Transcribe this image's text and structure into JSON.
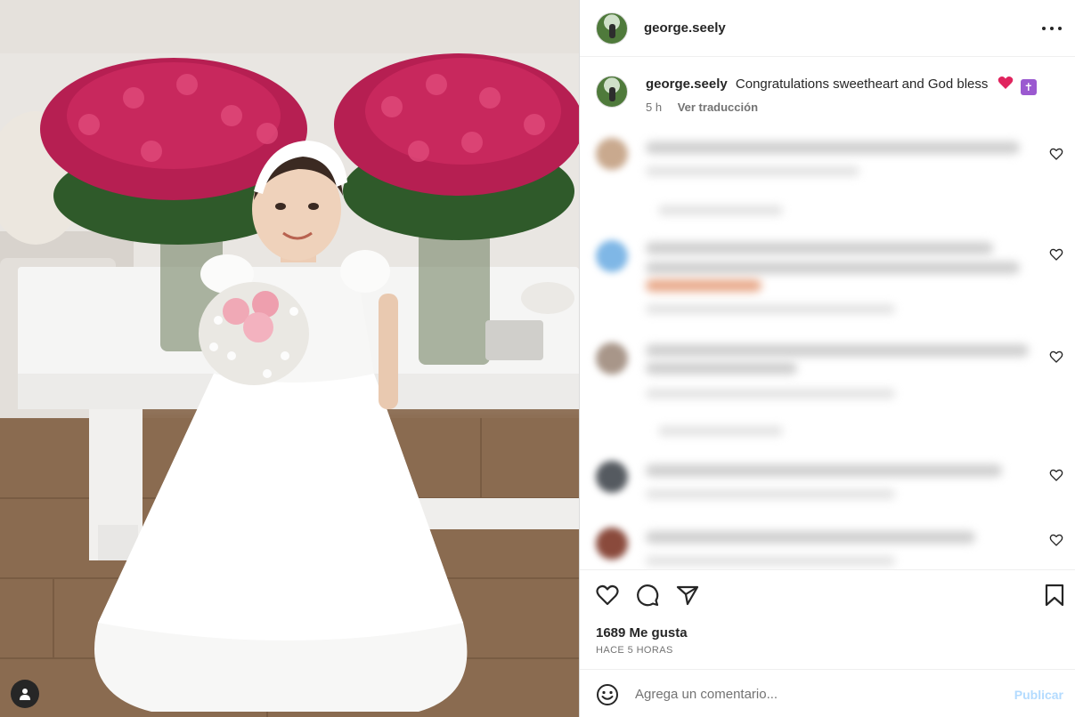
{
  "post": {
    "username": "george.seely",
    "caption_username": "george.seely",
    "caption_text": "Congratulations sweetheart and God bless",
    "caption_time": "5 h",
    "translate_label": "Ver traducción",
    "likes_text": "1689 Me gusta",
    "time_ago": "HACE 5 HORAS",
    "cross_glyph": "✝"
  },
  "comment_box": {
    "placeholder": "Agrega un comentario...",
    "post_label": "Publicar"
  },
  "icons": {
    "header_more": "more-options-icon",
    "like": "heart-icon",
    "comment": "comment-icon",
    "share": "share-icon",
    "save": "bookmark-icon",
    "emoji": "emoji-icon",
    "user_tag": "user-tag-icon"
  },
  "colors": {
    "text_primary": "#262626",
    "text_secondary": "#737373",
    "post_button_disabled": "#b3dbff",
    "heart_emoji": "#e0245e",
    "cross_emoji": "#9b59d0"
  }
}
